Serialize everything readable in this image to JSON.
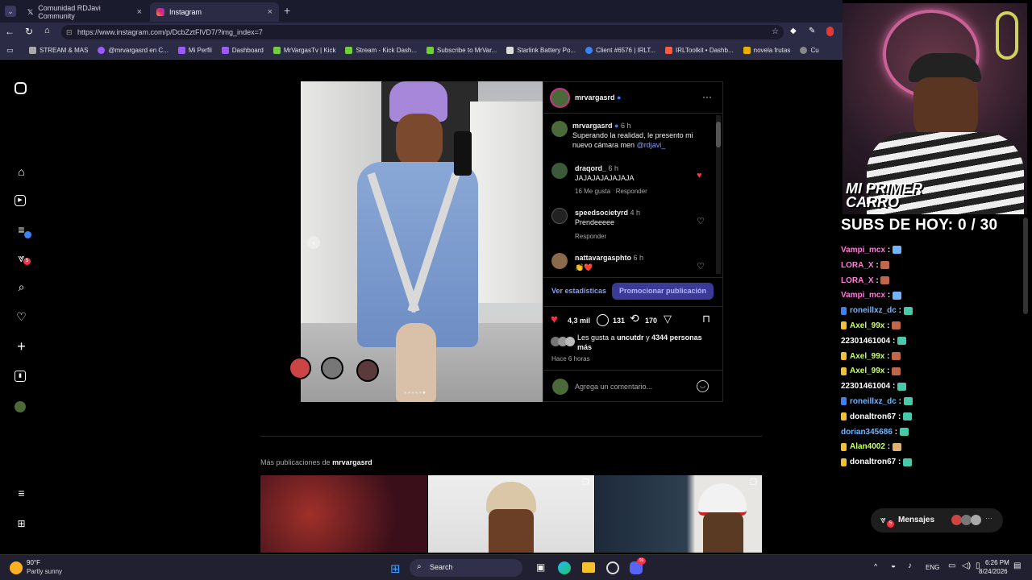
{
  "browser": {
    "tabs": [
      {
        "title": "Comunidad RDJavi Community",
        "active": false
      },
      {
        "title": "Instagram",
        "active": true
      }
    ],
    "url": "https://www.instagram.com/p/DcbZztFlVD7/?img_index=7",
    "bookmarks": [
      "STREAM & MAS",
      "@mrvargasrd en C...",
      "Mi Perfil",
      "Dashboard",
      "MrVargasTv | Kick",
      "Stream - Kick Dash...",
      "Subscribe to MrVar...",
      "Starlink Battery Po...",
      "Client #6576 | IRLT...",
      "IRLToolkit • Dashb...",
      "novela frutas",
      "Cu"
    ]
  },
  "sidebar": {
    "notif_badge": "5"
  },
  "post": {
    "username": "mrvargasrd",
    "caption_user": "mrvargasrd",
    "caption_time": "6 h",
    "caption_text": "Superando la realidad, le presento mi nuevo cámara men",
    "caption_mention": "@rdjavi_",
    "comments": [
      {
        "user": "draqord_",
        "time": "6 h",
        "text": "JAJAJAJAJAJAJA",
        "likes": "16 Me gusta",
        "reply": "Responder",
        "liked": true
      },
      {
        "user": "speedsocietyrd",
        "time": "4 h",
        "text": "Prendeeeee",
        "likes": "",
        "reply": "Responder",
        "liked": false
      },
      {
        "user": "nattavargasphto",
        "time": "6 h",
        "text": "👏❤️",
        "likes": "",
        "reply": "",
        "liked": false
      }
    ],
    "stats_link": "Ver estadísticas",
    "promote_button": "Promocionar publicación",
    "like_count": "4,3 mil",
    "comment_count": "131",
    "repost_count": "170",
    "liked_by_prefix": "Les gusta a",
    "liked_by_user": "uncutdr",
    "liked_by_suffix": "y",
    "liked_by_others": "4344 personas más",
    "time_ago": "Hace 6 horas",
    "comment_placeholder": "Agrega un comentario..."
  },
  "more_posts": {
    "label": "Más publicaciones de",
    "user": "mrvargasrd"
  },
  "overlay": {
    "cam_text": "MI PRIMER CARRO",
    "subs": "SUBS DE HOY: 0 / 30",
    "chat": [
      {
        "user": "Vampi_mcx",
        "color": "#ff7ad9"
      },
      {
        "user": "LORA_X",
        "color": "#ff7ad9"
      },
      {
        "user": "LORA_X",
        "color": "#ff7ad9"
      },
      {
        "user": "Vampi_mcx",
        "color": "#ff7ad9"
      },
      {
        "user": "roneillxz_dc",
        "color": "#6fb6ff"
      },
      {
        "user": "Axel_99x",
        "color": "#c9ff6f"
      },
      {
        "user": "22301461004",
        "color": "#ffffff"
      },
      {
        "user": "Axel_99x",
        "color": "#c9ff6f"
      },
      {
        "user": "Axel_99x",
        "color": "#c9ff6f"
      },
      {
        "user": "22301461004",
        "color": "#ffffff"
      },
      {
        "user": "roneillxz_dc",
        "color": "#6fb6ff"
      },
      {
        "user": "donaltron67",
        "color": "#ffffff"
      },
      {
        "user": "dorian345686",
        "color": "#6fb6ff"
      },
      {
        "user": "Alan4002",
        "color": "#c9ff6f"
      },
      {
        "user": "donaltron67",
        "color": "#ffffff"
      }
    ],
    "messages_label": "Mensajes",
    "messages_badge": "5"
  },
  "taskbar": {
    "temp": "90°F",
    "weather": "Partly sunny",
    "search": "Search",
    "lang": "ENG",
    "time": "6:26 PM",
    "date": "8/24/2026",
    "discord_badge": "99"
  },
  "colors": {
    "verified": "#3b82f6",
    "like": "#ff3040",
    "promote": "#3a3a99",
    "mention": "#8a9bff"
  }
}
